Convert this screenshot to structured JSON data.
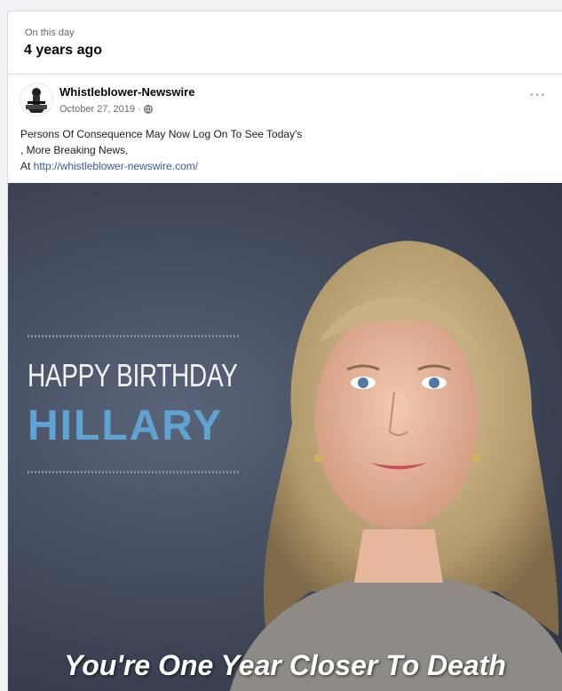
{
  "memory": {
    "kicker": "On this day",
    "title": "4 years ago"
  },
  "post": {
    "page_name": "Whistleblower-Newswire",
    "date": "October 27, 2019",
    "audience_icon": "globe-icon",
    "more_label": "···",
    "text_line1": "Persons Of Consequence May Now Log On To See Today's",
    "text_line2": ", More Breaking News,",
    "text_line3_prefix": "At ",
    "link": "http://whistleblower-newswire.com/"
  },
  "image": {
    "headline_top": "HAPPY BIRTHDAY",
    "headline_name": "HILLARY",
    "caption": "You're One Year Closer To Death"
  },
  "colors": {
    "name_blue": "#5fa3d3",
    "link_blue": "#385898",
    "background": "#3e4658"
  }
}
